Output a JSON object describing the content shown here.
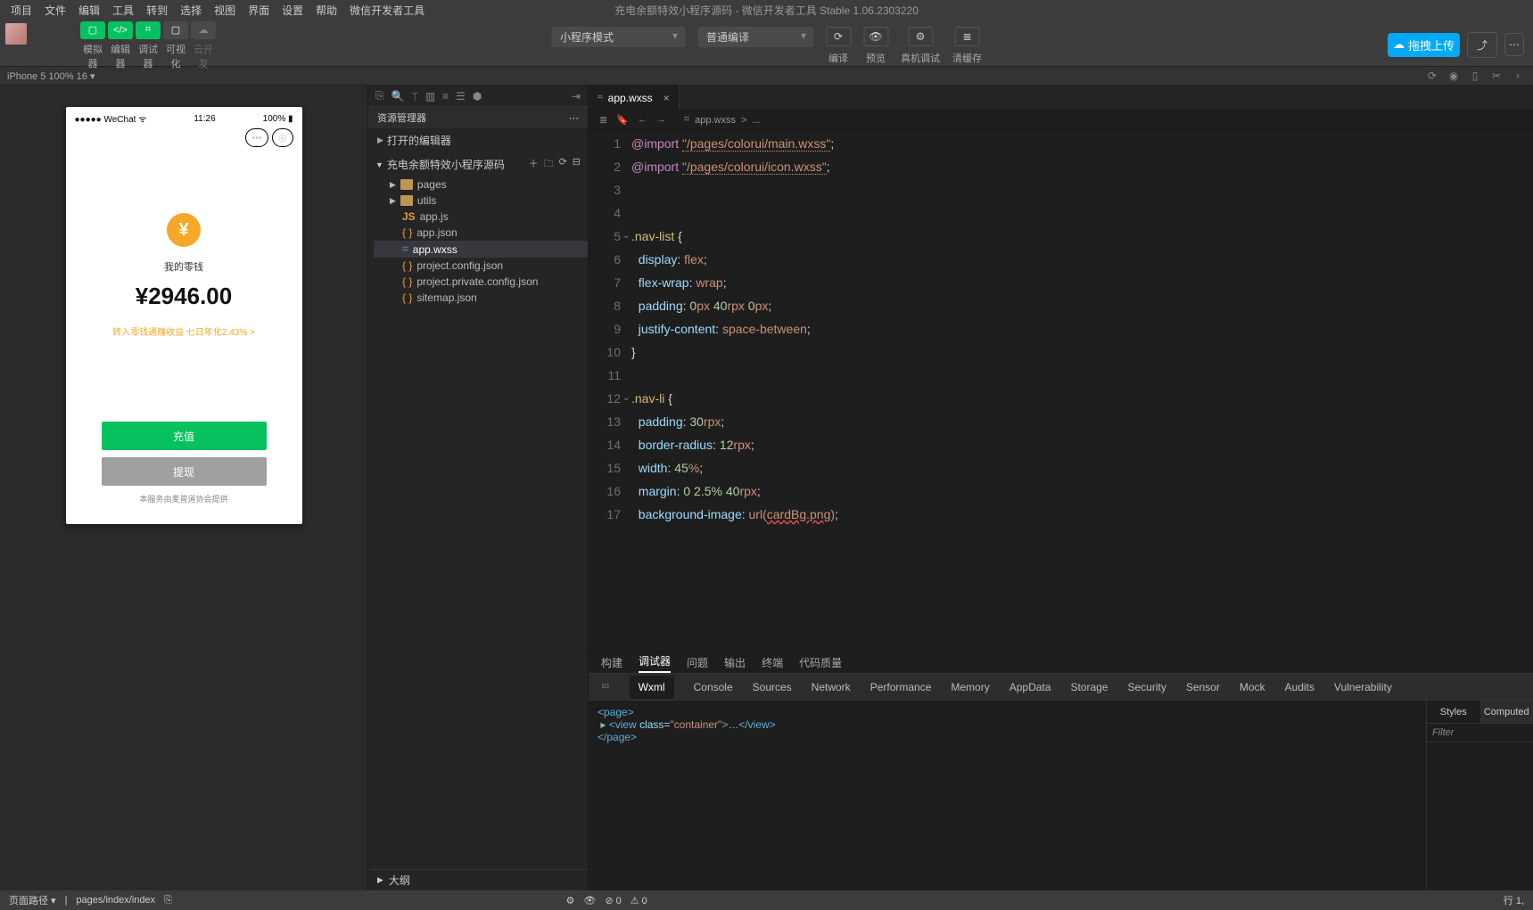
{
  "menubar": {
    "items": [
      "项目",
      "文件",
      "编辑",
      "工具",
      "转到",
      "选择",
      "视图",
      "界面",
      "设置",
      "帮助",
      "微信开发者工具"
    ]
  },
  "window_title": "充电余额特效小程序源码 - 微信开发者工具 Stable 1.06.2303220",
  "toolbar": {
    "labels": [
      "模拟器",
      "编辑器",
      "调试器",
      "可视化",
      "云开发"
    ],
    "mode_select": "小程序模式",
    "compile_select": "普通编译",
    "action_labels": [
      "编译",
      "预览",
      "真机调试",
      "清缓存"
    ],
    "cloud_btn": "拖拽上传"
  },
  "devicebar": {
    "text": "iPhone 5 100% 16 ▾"
  },
  "explorer": {
    "title": "资源管理器",
    "sec_open": "打开的编辑器",
    "root": "充电余额特效小程序源码",
    "items": [
      "pages",
      "utils",
      "app.js",
      "app.json",
      "app.wxss",
      "project.config.json",
      "project.private.config.json",
      "sitemap.json"
    ],
    "outline": "大纲"
  },
  "tab": {
    "filename": "app.wxss"
  },
  "crumbs": {
    "file": "app.wxss",
    "sep": ">",
    "dots": "..."
  },
  "code": {
    "import_kw": "@import",
    "s1": "\"/pages/colorui/main.wxss\"",
    "s2": "\"/pages/colorui/icon.wxss\"",
    "sel1": ".nav-list",
    "sel2": ".nav-li",
    "p_display": "display",
    "v_flex": "flex",
    "p_flexwrap": "flex-wrap",
    "v_wrap": "wrap",
    "p_padding": "padding",
    "v_pad1a": "0",
    "v_pad1b": "px ",
    "v_pad1c": "40",
    "v_pad1d": "rpx ",
    "v_pad1e": "0",
    "v_pad1f": "px",
    "p_justify": "justify-content",
    "v_sb": "space-between",
    "v_pad2a": "30",
    "v_pad2b": "rpx",
    "p_bradius": "border-radius",
    "v_br_a": "12",
    "v_br_b": "rpx",
    "p_width": "width",
    "v_w_a": "45",
    "v_w_pct": "%",
    "p_margin": "margin",
    "v_m_a": "0",
    "v_m_b": " 2.5% ",
    "v_m_c": "40",
    "v_m_d": "rpx",
    "p_bgimg": "background-image",
    "v_url_fn": "url(",
    "v_url": "cardBg.png",
    "v_url_close": ")",
    "lines": [
      "1",
      "2",
      "3",
      "4",
      "5",
      "6",
      "7",
      "8",
      "9",
      "10",
      "11",
      "12",
      "13",
      "14",
      "15",
      "16",
      "17"
    ]
  },
  "sim": {
    "carrier": "●●●●● WeChat",
    "wifi": "ᯤ",
    "time": "11:26",
    "battery": "100%",
    "coin": "¥",
    "t1": "我的零钱",
    "amount": "¥2946.00",
    "link": "转入零钱通赚收益 七日年化2.43% >",
    "btn1": "充值",
    "btn2": "提现",
    "foot": "本服务由麦普道协会提供"
  },
  "debugger": {
    "tabs1": [
      "构建",
      "调试器",
      "问题",
      "输出",
      "终端",
      "代码质量"
    ],
    "tabs2": [
      "Wxml",
      "Console",
      "Sources",
      "Network",
      "Performance",
      "Memory",
      "AppData",
      "Storage",
      "Security",
      "Sensor",
      "Mock",
      "Audits",
      "Vulnerability"
    ],
    "style_tabs": [
      "Styles",
      "Computed"
    ],
    "filter": "Filter",
    "dom_open": "<page>",
    "dom_row": "<view class=\"container\">…</view>",
    "dom_close": "</page>"
  },
  "statusbar": {
    "path_label": "页面路径 ▾",
    "sep": "|",
    "path": "pages/index/index",
    "right": "行 1,"
  }
}
